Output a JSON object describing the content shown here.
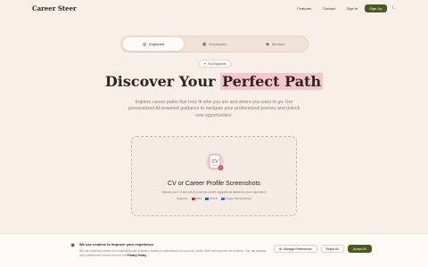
{
  "header": {
    "logo": "Career Steer",
    "nav": [
      "Features",
      "Contact",
      "Sign In"
    ],
    "signup": "Sign Up",
    "theme_icon": "moon-icon"
  },
  "tabs": [
    {
      "label": "Explorers",
      "icon": "compass-icon",
      "active": true
    },
    {
      "label": "Employees",
      "icon": "briefcase-icon",
      "active": false
    },
    {
      "label": "Mentors",
      "icon": "graduation-cap-icon",
      "active": false
    }
  ],
  "badge": {
    "label": "For Explorers",
    "icon": "sparkle-icon"
  },
  "hero": {
    "title_prefix": "Discover Your ",
    "title_highlight": "Perfect Path",
    "subtitle": "Explore career paths that truly fit who you are and where you want to go. Get personalised AI-powered guidance to navigate your professional journey and unlock new opportunities."
  },
  "upload": {
    "title": "CV or Career Profile Screenshots",
    "description": "Upload your CV and get AI-powered career suggestions tailored to your experience",
    "formats_label": "Supports:",
    "formats": [
      {
        "label": "PDF",
        "color": "#c0392b"
      },
      {
        "label": "DOCX",
        "color": "#2b5fb3"
      },
      {
        "label": "Images (Screenshots)",
        "color": "#3b6fc0"
      }
    ]
  },
  "cookie": {
    "title": "We use cookies to improve your experience",
    "text": "We use essential cookies for functionality and analytics cookies to understand how you use Career Steer and improve our services. You can manage your preferences or learn more in our",
    "link": "Privacy Policy",
    "buttons": {
      "manage": "Manage Preferences",
      "reject": "Reject All",
      "accept": "Accept All"
    }
  },
  "colors": {
    "brand": "#4a5a1f",
    "highlight": "#f6c6ce",
    "background": "#f7efe8"
  }
}
